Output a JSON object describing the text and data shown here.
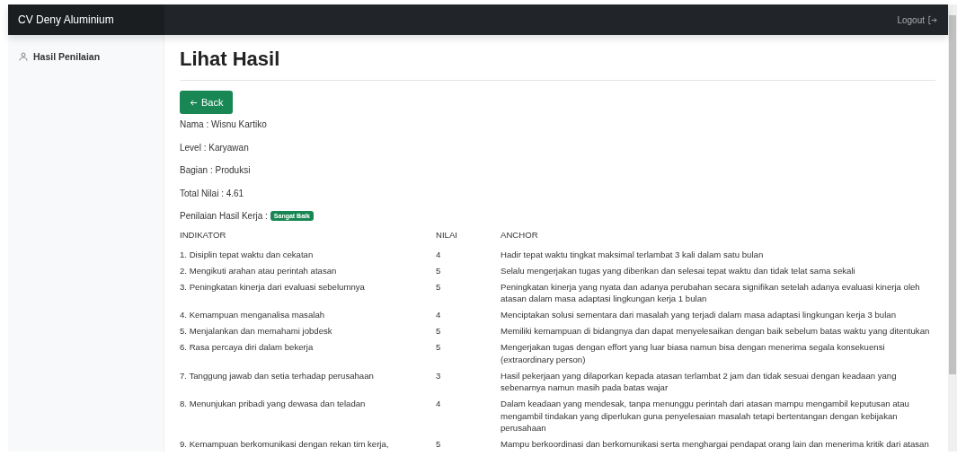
{
  "navbar": {
    "brand": "CV Deny Aluminium",
    "logout": "Logout"
  },
  "sidebar": {
    "items": [
      {
        "label": "Hasil Penilaian",
        "selected": true
      }
    ]
  },
  "page": {
    "title": "Lihat Hasil",
    "back_button": "Back",
    "info": [
      "Nama : Wisnu Kartiko",
      "Level : Karyawan",
      "Bagian : Produksi",
      "Total Nilai : 4.61"
    ],
    "rating_label": "Penilaian Hasil Kerja :",
    "rating_badge": "Sangat Baik"
  },
  "table": {
    "columns": [
      "INDIKATOR",
      "NILAI",
      "ANCHOR"
    ],
    "rows": [
      [
        "1. Disiplin tepat waktu dan cekatan",
        "4",
        "Hadir tepat waktu tingkat maksimal terlambat 3 kali dalam satu bulan"
      ],
      [
        "2. Mengikuti arahan atau perintah atasan",
        "5",
        "Selalu mengerjakan tugas yang diberikan dan selesai tepat waktu dan tidak telat sama sekali"
      ],
      [
        "3. Peningkatan kinerja dari evaluasi sebelumnya",
        "5",
        "Peningkatan kinerja yang nyata dan adanya perubahan secara signifikan setelah adanya evaluasi kinerja oleh atasan dalam masa adaptasi lingkungan kerja 1 bulan"
      ],
      [
        "4. Kemampuan menganalisa masalah",
        "4",
        "Menciptakan solusi sementara dari masalah yang terjadi dalam masa adaptasi lingkungan kerja 3 bulan"
      ],
      [
        "5. Menjalankan dan memahami jobdesk",
        "5",
        "Memiliki kemampuan di bidangnya dan dapat menyelesaikan dengan baik sebelum batas waktu yang ditentukan"
      ],
      [
        "6. Rasa percaya diri dalam bekerja",
        "5",
        "Mengerjakan tugas dengan effort yang luar biasa namun bisa dengan menerima segala konsekuensi (extraordinary person)"
      ],
      [
        "7. Tanggung jawab dan setia terhadap perusahaan",
        "3",
        "Hasil pekerjaan yang dilaporkan kepada atasan terlambat 2 jam dan tidak sesuai dengan keadaan yang sebenarnya namun masih pada batas wajar"
      ],
      [
        "8. Menunjukan pribadi yang dewasa dan teladan",
        "4",
        "Dalam keadaan yang mendesak, tanpa menunggu perintah dari atasan mampu mengambil keputusan atau mengambil tindakan yang diperlukan guna penyelesaian masalah tetapi bertentangan dengan kebijakan perusahaan"
      ],
      [
        "9. Kemampuan berkomunikasi dengan rekan tim kerja,",
        "5",
        "Mampu berkoordinasi dan berkomunikasi serta menghargai pendapat orang lain dan menerima kritik dari atasan"
      ]
    ]
  }
}
